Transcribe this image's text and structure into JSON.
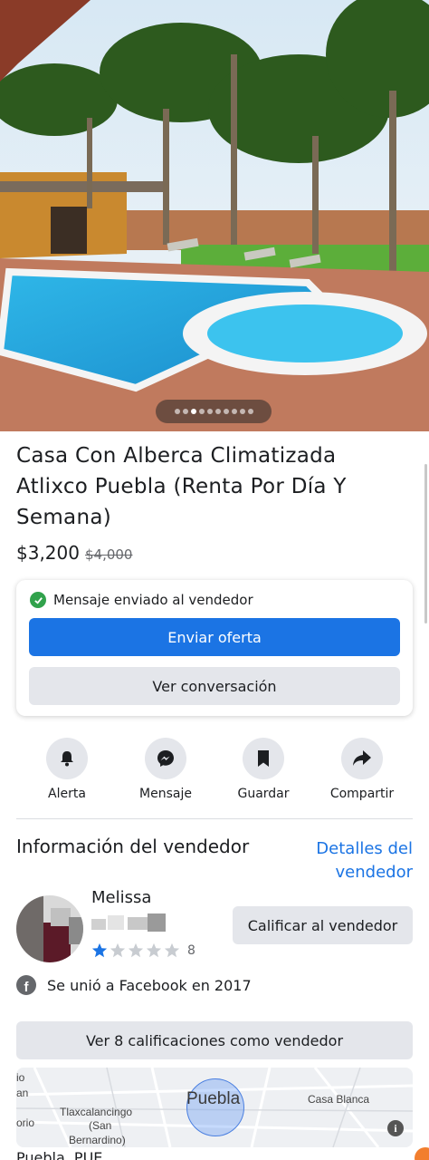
{
  "listing": {
    "title": "Casa Con Alberca Climatizada Atlixco Puebla (Renta Por Día Y Semana)",
    "price": "$3,200",
    "original_price": "$4,000",
    "photo_count": 10,
    "active_photo_index": 2
  },
  "message_card": {
    "status": "Mensaje enviado al vendedor",
    "offer_button": "Enviar oferta",
    "conversation_button": "Ver conversación"
  },
  "actions": [
    {
      "label": "Alerta",
      "icon": "bell-icon"
    },
    {
      "label": "Mensaje",
      "icon": "messenger-icon"
    },
    {
      "label": "Guardar",
      "icon": "bookmark-icon"
    },
    {
      "label": "Compartir",
      "icon": "share-icon"
    }
  ],
  "seller": {
    "heading": "Información del vendedor",
    "details_link": "Detalles del vendedor",
    "name": "Melissa",
    "rating": 1,
    "rating_max": 5,
    "rating_count": "8",
    "rate_button": "Calificar al vendedor",
    "joined": "Se unió a Facebook en 2017",
    "ratings_button": "Ver 8 calificaciones como vendedor"
  },
  "map": {
    "city": "Puebla",
    "labels": [
      "io",
      "an",
      "orio",
      "Tlaxcalancingo",
      "(San",
      "Bernardino)",
      "Casa Blanca"
    ]
  },
  "footer": {
    "location": "Puebla, PUE"
  },
  "colors": {
    "accent": "#1b74e4",
    "button_gray": "#e4e6eb",
    "success": "#31a24c",
    "star_active": "#1b74e4",
    "star_inactive": "#c8ccd1"
  }
}
